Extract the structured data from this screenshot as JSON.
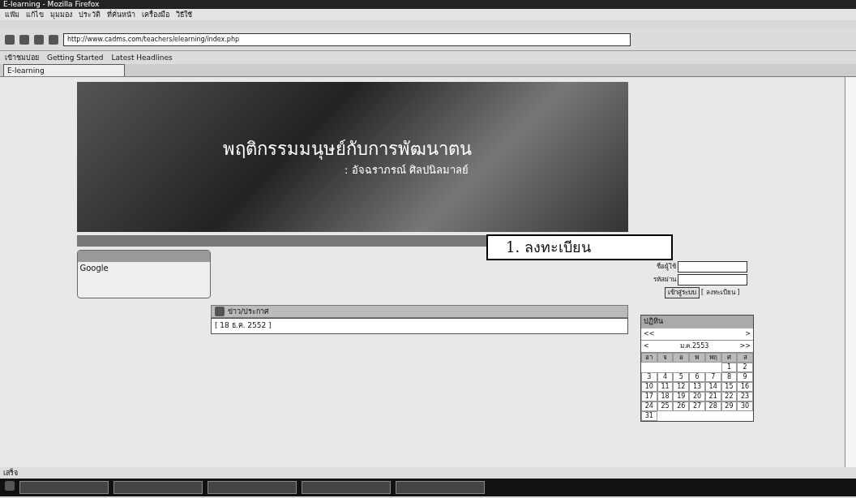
{
  "window": {
    "title": "E-learning - Mozilla Firefox"
  },
  "menu": [
    "แฟ้ม",
    "แก้ไข",
    "มุมมอง",
    "ประวัติ",
    "ที่คั่นหน้า",
    "เครื่องมือ",
    "วิธีใช้"
  ],
  "address": {
    "url": "http://www.cadms.com/teachers/elearning/index.php"
  },
  "bookmarks": [
    "เข้าชมบ่อย",
    "Getting Started",
    "Latest Headlines"
  ],
  "tabs": [
    {
      "label": "E-learning",
      "selected": true
    }
  ],
  "banner": {
    "title": "พฤติกรรมมนุษย์กับการพัฒนาตน",
    "author": ": อัจฉราภรณ์ ศิลปนิลมาลย์"
  },
  "sidebar": {
    "items": [
      "Google"
    ]
  },
  "news": {
    "title": "ข่าว/ประกาศ",
    "items": [
      {
        "date": "[ 18 ธ.ค. 2552 ]"
      }
    ]
  },
  "callout": {
    "text": "1. ลงทะเบียน"
  },
  "login": {
    "fields": [
      {
        "label": "ชื่อผู้ใช้"
      },
      {
        "label": "รหัสผ่าน"
      }
    ],
    "submit": "เข้าสู่ระบบ",
    "register": "[ ลงทะเบียน ]"
  },
  "calendar": {
    "title": "ปฏิทิน",
    "prev_year": "<<",
    "next_month": ">",
    "prev_month": "<",
    "next_year": ">>",
    "month": "ม.ค.2553",
    "weekdays": [
      "อา",
      "จ",
      "อ",
      "พ",
      "พฤ",
      "ศ",
      "ส"
    ],
    "days": [
      "1",
      "2",
      "3",
      "4",
      "5",
      "6",
      "7",
      "8",
      "9",
      "10",
      "11",
      "12",
      "13",
      "14",
      "15",
      "16",
      "17",
      "18",
      "19",
      "20",
      "21",
      "22",
      "23",
      "24",
      "25",
      "26",
      "27",
      "28",
      "29",
      "30",
      "31"
    ]
  },
  "status_bar": {
    "text": "เสร็จ"
  }
}
